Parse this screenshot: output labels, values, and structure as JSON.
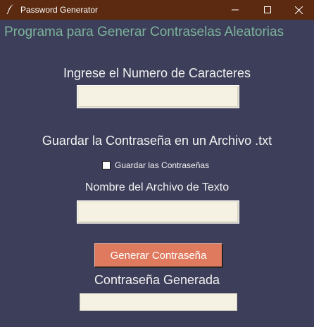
{
  "window": {
    "title": "Password Generator",
    "icon": "feather-icon"
  },
  "colors": {
    "background": "#3d3e59",
    "titlebar": "#5b2a10",
    "heading": "#7bb39a",
    "button": "#e07a5f",
    "entry": "#f5f2e3"
  },
  "main": {
    "heading": "Programa para Generar Contraselas Aleatorias",
    "chars_label": "Ingrese el Numero de Caracteres",
    "chars_value": "",
    "save_label": "Guardar la Contraseña en un Archivo .txt",
    "save_checkbox_label": "Guardar las Contraseñas",
    "save_checked": false,
    "filename_label": "Nombre del Archivo de Texto",
    "filename_value": "",
    "generate_button": "Generar Contraseña",
    "generated_label": "Contraseña Generada",
    "generated_value": ""
  }
}
